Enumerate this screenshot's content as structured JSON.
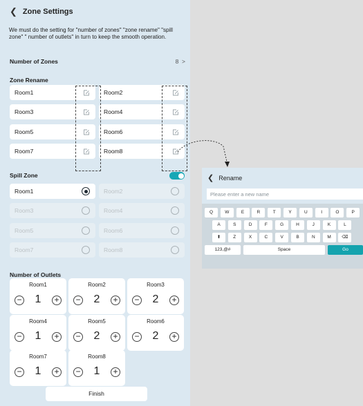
{
  "header": {
    "back_icon": "chevron-left-icon",
    "title": "Zone Settings"
  },
  "intro": "We must do the setting for \"number of zones\" \"zone rename\" \"spill zone\" \" number of outlets\" in turn to keep the smooth operation.",
  "number_of_zones": {
    "label": "Number of Zones",
    "value": "8",
    "chevron": ">"
  },
  "zone_rename": {
    "heading": "Zone Rename",
    "rooms": [
      "Room1",
      "Room2",
      "Room3",
      "Room4",
      "Room5",
      "Room6",
      "Room7",
      "Room8"
    ]
  },
  "spill_zone": {
    "heading": "Spill Zone",
    "enabled": true,
    "selected": "Room1",
    "rooms": [
      "Room1",
      "Room2",
      "Room3",
      "Room4",
      "Room5",
      "Room6",
      "Room7",
      "Room8"
    ]
  },
  "outlets": {
    "heading": "Number of Outlets",
    "minus": "−",
    "plus": "+",
    "items": [
      {
        "room": "Room1",
        "count": "1"
      },
      {
        "room": "Room2",
        "count": "2"
      },
      {
        "room": "Room3",
        "count": "2"
      },
      {
        "room": "Room4",
        "count": "1"
      },
      {
        "room": "Room5",
        "count": "2"
      },
      {
        "room": "Room6",
        "count": "2"
      },
      {
        "room": "Room7",
        "count": "1"
      },
      {
        "room": "Room8",
        "count": "1"
      }
    ]
  },
  "finish_label": "Finish",
  "rename_panel": {
    "back_icon": "chevron-left-icon",
    "title": "Rename",
    "placeholder": "Please enter a new name",
    "keyboard": {
      "row1": [
        "Q",
        "W",
        "E",
        "R",
        "T",
        "Y",
        "U",
        "I",
        "O",
        "P"
      ],
      "row2": [
        "A",
        "S",
        "D",
        "F",
        "G",
        "H",
        "J",
        "K",
        "L"
      ],
      "row3": [
        "⬆",
        "Z",
        "X",
        "C",
        "V",
        "B",
        "N",
        "M",
        "⌫"
      ],
      "row4": [
        "123,@#",
        "Space",
        "Go"
      ]
    }
  },
  "colors": {
    "accent": "#17a7b5",
    "background": "#dbe8f1"
  }
}
